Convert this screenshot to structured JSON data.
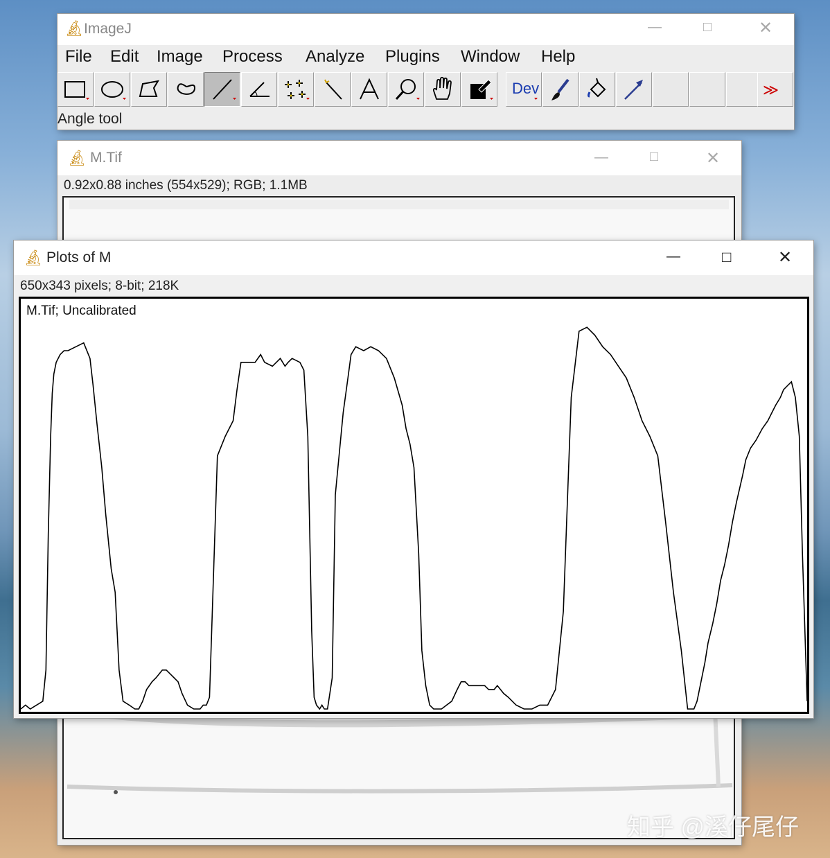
{
  "imagej": {
    "title": "ImageJ",
    "menu": [
      "File",
      "Edit",
      "Image",
      "Process",
      "Analyze",
      "Plugins",
      "Window",
      "Help"
    ],
    "tools": [
      {
        "name": "rectangle-tool-icon"
      },
      {
        "name": "oval-tool-icon"
      },
      {
        "name": "polygon-tool-icon"
      },
      {
        "name": "freehand-tool-icon"
      },
      {
        "name": "line-tool-icon",
        "selected": true
      },
      {
        "name": "angle-tool-icon"
      },
      {
        "name": "multipoint-tool-icon"
      },
      {
        "name": "wand-tool-icon"
      },
      {
        "name": "text-tool-icon"
      },
      {
        "name": "magnifier-tool-icon"
      },
      {
        "name": "hand-tool-icon"
      },
      {
        "name": "color-picker-tool-icon"
      },
      {
        "name": "developer-menu-icon"
      },
      {
        "name": "brush-tool-icon"
      },
      {
        "name": "flood-fill-tool-icon"
      },
      {
        "name": "arrow-tool-icon"
      },
      {
        "name": "empty-slot"
      },
      {
        "name": "empty-slot"
      },
      {
        "name": "empty-slot"
      },
      {
        "name": "more-tools-icon"
      }
    ],
    "dev_label": "Dev",
    "status": "Angle tool"
  },
  "mtif": {
    "title": "M.Tif",
    "info": "0.92x0.88 inches (554x529); RGB; 1.1MB"
  },
  "plots": {
    "title": "Plots of M",
    "info": "650x343 pixels; 8-bit; 218K",
    "plot_label": "M.Tif; Uncalibrated"
  },
  "chart_data": {
    "type": "line",
    "title": "M.Tif; Uncalibrated",
    "xlabel": "",
    "ylabel": "",
    "grid": false,
    "xlim": [
      0,
      1000
    ],
    "ylim": [
      0,
      100
    ],
    "series": [
      {
        "x": [
          0,
          6,
          12,
          20,
          28,
          32,
          35,
          38,
          40,
          42,
          45,
          50,
          55,
          60,
          70,
          80,
          88,
          92,
          97,
          103,
          108,
          112,
          115,
          120,
          125,
          130,
          138,
          145,
          150,
          155,
          160,
          167,
          172,
          176,
          180,
          185,
          190,
          195,
          200,
          205,
          212,
          220,
          228,
          232,
          236,
          240,
          250,
          260,
          270,
          275,
          280,
          290,
          298,
          305,
          310,
          320,
          325,
          330,
          336,
          340,
          345,
          355,
          360,
          365,
          370,
          373,
          376,
          380,
          383,
          386,
          390,
          396,
          400,
          410,
          416,
          420,
          426,
          436,
          445,
          455,
          465,
          475,
          485,
          490,
          495,
          500,
          506,
          510,
          515,
          520,
          525,
          535,
          548,
          555,
          560,
          565,
          570,
          575,
          580,
          585,
          590,
          595,
          598,
          602,
          606,
          610,
          614,
          620,
          630,
          640,
          650,
          660,
          670,
          680,
          690,
          700,
          710,
          720,
          730,
          740,
          750,
          760,
          770,
          780,
          790,
          800,
          810,
          820,
          830,
          840,
          848,
          852,
          856,
          860,
          865,
          870,
          874,
          880,
          885,
          890,
          895,
          900,
          905,
          910,
          918,
          922,
          928,
          935,
          943,
          950,
          955,
          960,
          966,
          970,
          975,
          980,
          985,
          990,
          994,
          1000
        ],
        "values": [
          0,
          1,
          0,
          1,
          2,
          10,
          45,
          70,
          81,
          86,
          89,
          91,
          92,
          92,
          93,
          94,
          90,
          83,
          73,
          62,
          50,
          42,
          36,
          30,
          10,
          2,
          1,
          0,
          0,
          2,
          5,
          7,
          8,
          9,
          10,
          10,
          9,
          8,
          7,
          4,
          1,
          0,
          0,
          1,
          1,
          3,
          65,
          70,
          74,
          82,
          89,
          89,
          89,
          91,
          89,
          88,
          89,
          90,
          88,
          89,
          90,
          89,
          87,
          70,
          20,
          3,
          1,
          0,
          1,
          0,
          0,
          8,
          55,
          76,
          85,
          91,
          93,
          92,
          93,
          92,
          90,
          85,
          78,
          72,
          68,
          62,
          40,
          15,
          6,
          1,
          0,
          0,
          2,
          5,
          7,
          7,
          6,
          6,
          6,
          6,
          6,
          5,
          5,
          5,
          6,
          5,
          4,
          3,
          1,
          0,
          0,
          1,
          1,
          5,
          25,
          80,
          97,
          98,
          96,
          93,
          91,
          88,
          85,
          80,
          74,
          70,
          65,
          48,
          30,
          15,
          0,
          0,
          0,
          2,
          7,
          12,
          17,
          22,
          27,
          33,
          37,
          42,
          48,
          53,
          60,
          64,
          67,
          69,
          72,
          74,
          76,
          78,
          80,
          82,
          83,
          84,
          80,
          70,
          40,
          2
        ]
      }
    ]
  },
  "watermark": "知乎 @溪仔尾仔"
}
